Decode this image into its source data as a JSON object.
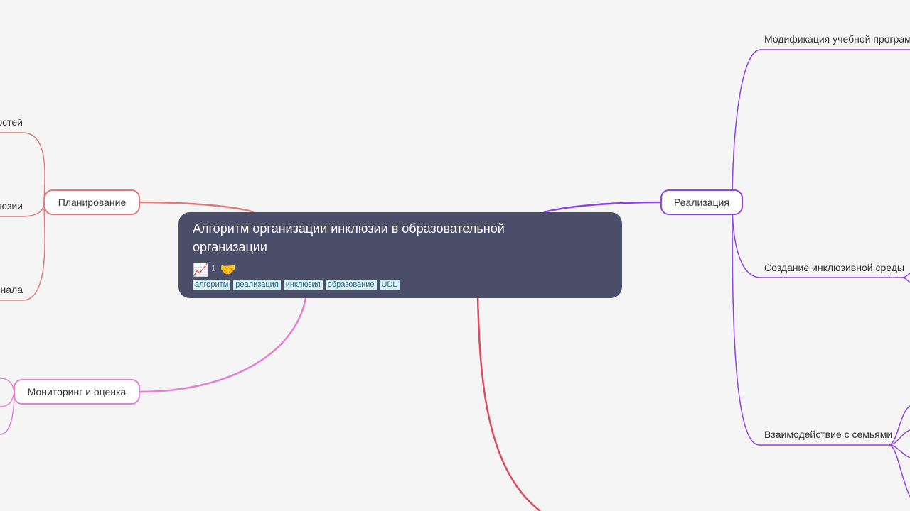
{
  "root": {
    "title": "Алгоритм организации инклюзии в образовательной организации",
    "emoji": [
      "📈",
      "🤝"
    ],
    "separator": "1",
    "tags": [
      "алгоритм",
      "реализация",
      "инклюзия",
      "образование",
      "UDL"
    ]
  },
  "branches": {
    "planning": {
      "label": "Планирование",
      "color": "#e07a78"
    },
    "monitoring": {
      "label": "Мониторинг и оценка",
      "color": "#e57fd1"
    },
    "implementation": {
      "label": "Реализация",
      "color": "#8e44e0"
    },
    "bottom": {
      "color": "#e04a5b"
    }
  },
  "leaves": {
    "planning": [
      "остей",
      "юзии",
      "онала"
    ],
    "implementation": [
      "Модификация учебной программы",
      "Создание инклюзивной среды",
      "Взаимодействие с семьями"
    ]
  }
}
